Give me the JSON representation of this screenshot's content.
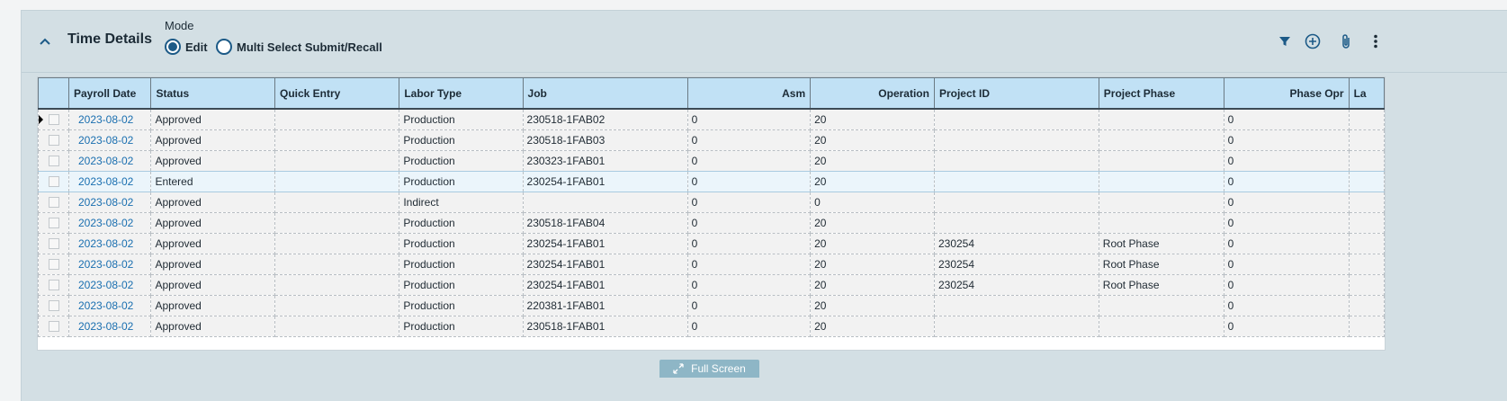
{
  "panel": {
    "title": "Time Details",
    "mode_label": "Mode",
    "mode_options": [
      {
        "label": "Edit",
        "selected": true
      },
      {
        "label": "Multi Select Submit/Recall",
        "selected": false
      }
    ],
    "toolbar_icons": [
      "filter-icon",
      "add-circle-icon",
      "paperclip-icon",
      "more-vertical-icon"
    ],
    "accent_color": "#1c5a87"
  },
  "grid": {
    "columns": [
      "Payroll Date",
      "Status",
      "Quick Entry",
      "Labor Type",
      "Job",
      "Asm",
      "Operation",
      "Project ID",
      "Project Phase",
      "Phase Opr",
      "La"
    ],
    "rows": [
      [
        "2023-08-02",
        "Approved",
        "",
        "Production",
        "230518-1FAB02",
        "0",
        "20",
        "",
        "",
        "0"
      ],
      [
        "2023-08-02",
        "Approved",
        "",
        "Production",
        "230518-1FAB03",
        "0",
        "20",
        "",
        "",
        "0"
      ],
      [
        "2023-08-02",
        "Approved",
        "",
        "Production",
        "230323-1FAB01",
        "0",
        "20",
        "",
        "",
        "0"
      ],
      [
        "2023-08-02",
        "Entered",
        "",
        "Production",
        "230254-1FAB01",
        "0",
        "20",
        "",
        "",
        "0"
      ],
      [
        "2023-08-02",
        "Approved",
        "",
        "Indirect",
        "",
        "0",
        "0",
        "",
        "",
        "0"
      ],
      [
        "2023-08-02",
        "Approved",
        "",
        "Production",
        "230518-1FAB04",
        "0",
        "20",
        "",
        "",
        "0"
      ],
      [
        "2023-08-02",
        "Approved",
        "",
        "Production",
        "230254-1FAB01",
        "0",
        "20",
        "230254",
        "Root Phase",
        "0"
      ],
      [
        "2023-08-02",
        "Approved",
        "",
        "Production",
        "230254-1FAB01",
        "0",
        "20",
        "230254",
        "Root Phase",
        "0"
      ],
      [
        "2023-08-02",
        "Approved",
        "",
        "Production",
        "230254-1FAB01",
        "0",
        "20",
        "230254",
        "Root Phase",
        "0"
      ],
      [
        "2023-08-02",
        "Approved",
        "",
        "Production",
        "220381-1FAB01",
        "0",
        "20",
        "",
        "",
        "0"
      ],
      [
        "2023-08-02",
        "Approved",
        "",
        "Production",
        "230518-1FAB01",
        "0",
        "20",
        "",
        "",
        "0"
      ]
    ],
    "selected_row_index": 3
  },
  "fullscreen_label": "Full Screen"
}
